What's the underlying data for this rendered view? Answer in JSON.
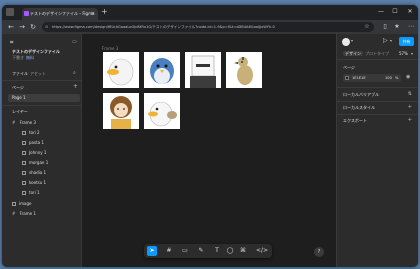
{
  "browser": {
    "tab_title": "テストのデザインファイル – Figma",
    "url": "https://www.figma.com/design/f6UrAGaaaLoOJdfXRx1G/テストのデザインファイル?node-id=1-9&p=f&t=dDB4A6GoalJJxWYh-0"
  },
  "left_panel": {
    "file_title": "テストのデザインファイル",
    "team": "下書き",
    "plan_badge": "無料",
    "tabs": [
      "ファイル",
      "アセット"
    ],
    "pages_heading": "ページ",
    "page_item": "Page 1",
    "layers_heading": "レイヤー",
    "layers": [
      "Frame 3",
      "tori 2",
      "pasta 1",
      "Johnny 1",
      "morgan 1",
      "shadia 1",
      "koetsu 1",
      "tori 1",
      "image",
      "Frame 1"
    ]
  },
  "canvas": {
    "frame_label": "Frame 3"
  },
  "right_panel": {
    "avatar_initial": "",
    "share_label": "共有",
    "tabs": [
      "デザイン",
      "プロトタイプ"
    ],
    "zoom": "57%",
    "page_heading": "ページ",
    "page_color_hex": "1E1E1E",
    "page_color_opacity": "100",
    "page_color_unit": "%",
    "sections": [
      "ローカルバリアブル",
      "ローカルスタイル",
      "エクスポート"
    ]
  },
  "toolbar": {
    "tools": [
      "move-tool",
      "frame-tool",
      "shape-tool",
      "pen-tool",
      "text-tool",
      "comment-tool",
      "actions-tool",
      "dev-mode-toggle"
    ]
  },
  "colors": {
    "accent": "#0d99ff",
    "canvas_bg": "#1e1e1e",
    "panel_bg": "#2c2c2c"
  }
}
